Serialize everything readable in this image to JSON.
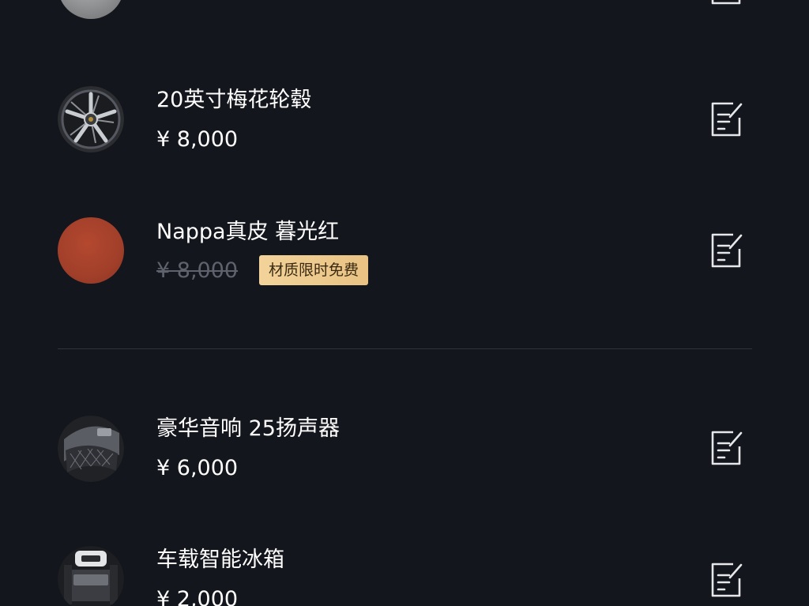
{
  "items": [
    {
      "name": "",
      "price": "",
      "icon": "gray-sphere-thumbnail"
    },
    {
      "name": "20英寸梅花轮毂",
      "price": "¥ 8,000",
      "icon": "wheel-rim-thumbnail"
    },
    {
      "name": "Nappa真皮 暮光红",
      "price": "¥ 8,000",
      "price_struck": true,
      "badge": "材质限时免费",
      "icon": "red-leather-swatch",
      "swatch_color": "#a8412c"
    },
    {
      "name": "豪华音响 25扬声器",
      "price": "¥ 6,000",
      "icon": "speaker-thumbnail"
    },
    {
      "name": "车载智能冰箱",
      "price": "¥ 2,000",
      "icon": "car-fridge-thumbnail"
    }
  ],
  "colors": {
    "background": "#14161d",
    "divider": "#30333b",
    "struck_price": "#5e626c",
    "badge_bg": "#f0cf93",
    "badge_text": "#3a2a12",
    "icon_stroke": "#e6e7ea"
  }
}
